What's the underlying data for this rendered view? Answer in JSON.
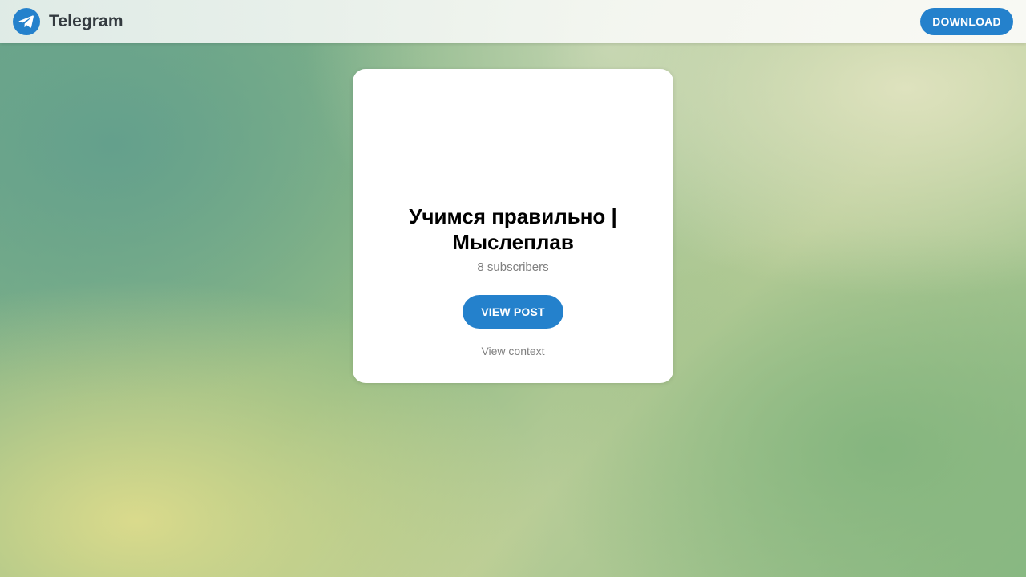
{
  "header": {
    "brand_name": "Telegram",
    "logo_icon": "telegram-plane-icon",
    "download_label": "DOWNLOAD"
  },
  "channel": {
    "title": "Учимся правильно | Мыслеплав",
    "subscribers": "8 subscribers",
    "view_post_label": "VIEW POST",
    "view_context_label": "View context"
  },
  "colors": {
    "accent": "#2481cc",
    "muted_text": "#808080",
    "card_background": "#ffffff"
  }
}
